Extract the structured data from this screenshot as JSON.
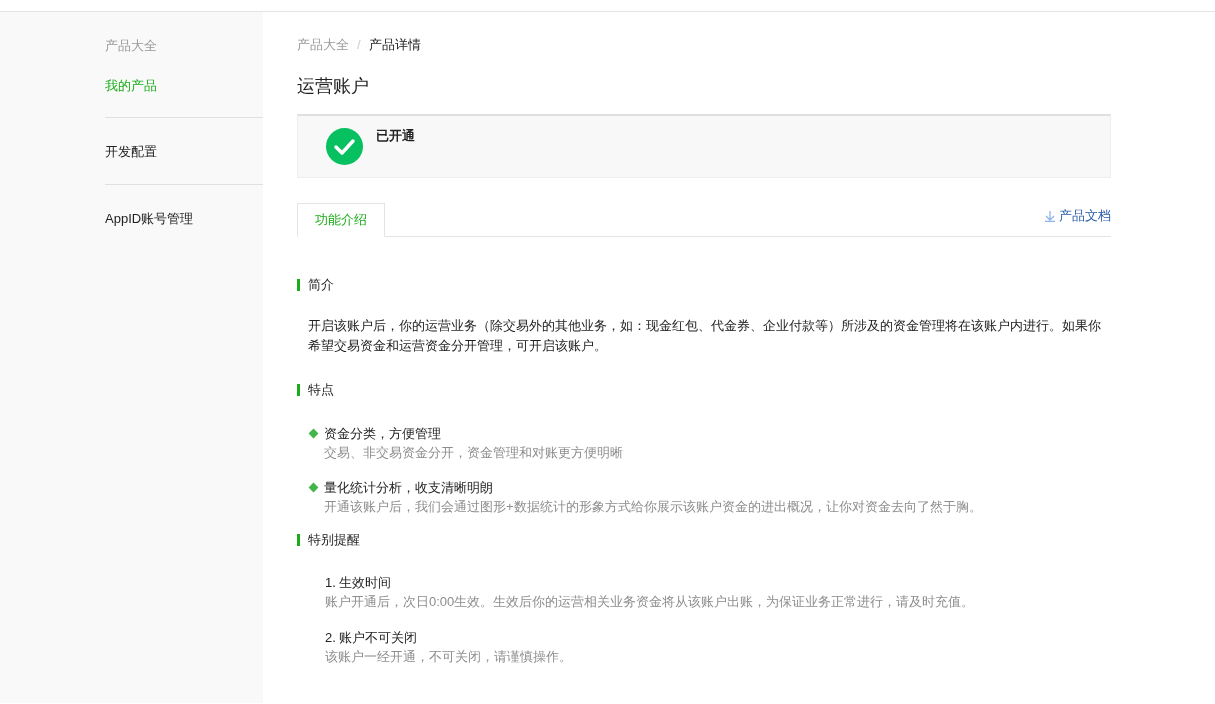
{
  "sidebar": {
    "sections": [
      {
        "heading": "产品大全",
        "items": [
          {
            "label": "我的产品",
            "selected": true
          }
        ]
      },
      {
        "items": [
          {
            "label": "开发配置",
            "selected": false
          }
        ]
      },
      {
        "items": [
          {
            "label": "AppID账号管理",
            "selected": false
          }
        ]
      }
    ]
  },
  "breadcrumb": [
    {
      "label": "产品大全",
      "current": false
    },
    {
      "label": "/",
      "kind": "separator"
    },
    {
      "label": "产品详情",
      "current": true
    }
  ],
  "title": "运营账户",
  "status": {
    "label": "已开通",
    "enabled": true
  },
  "tabs": [
    {
      "label": "功能介绍",
      "selected": true
    }
  ],
  "doc_link": "产品文档",
  "sections": [
    {
      "heading": "简介",
      "kind": "paragraph",
      "text": "开启该账户后，你的运营业务（除交易外的其他业务，如：现金红包、代金券、企业付款等）所涉及的资金管理将在该账户内进行。如果你希望交易资金和运营资金分开管理，可开启该账户。"
    },
    {
      "heading": "特点",
      "kind": "features",
      "items": [
        {
          "title": "资金分类，方便管理",
          "description": "交易、非交易资金分开，资金管理和对账更方便明晰"
        },
        {
          "title": "量化统计分析，收支清晰明朗",
          "description": "开通该账户后，我们会通过图形+数据统计的形象方式给你展示该账户资金的进出概况，让你对资金去向了然于胸。"
        }
      ]
    },
    {
      "heading": "特别提醒",
      "kind": "notes",
      "items": [
        {
          "title": "1. 生效时间",
          "description": "账户开通后，次日0:00生效。生效后你的运营相关业务资金将从该账户出账，为保证业务正常进行，请及时充值。"
        },
        {
          "title": "2. 账户不可关闭",
          "description": "该账户一经开通，不可关闭，请谨慎操作。"
        }
      ]
    }
  ]
}
